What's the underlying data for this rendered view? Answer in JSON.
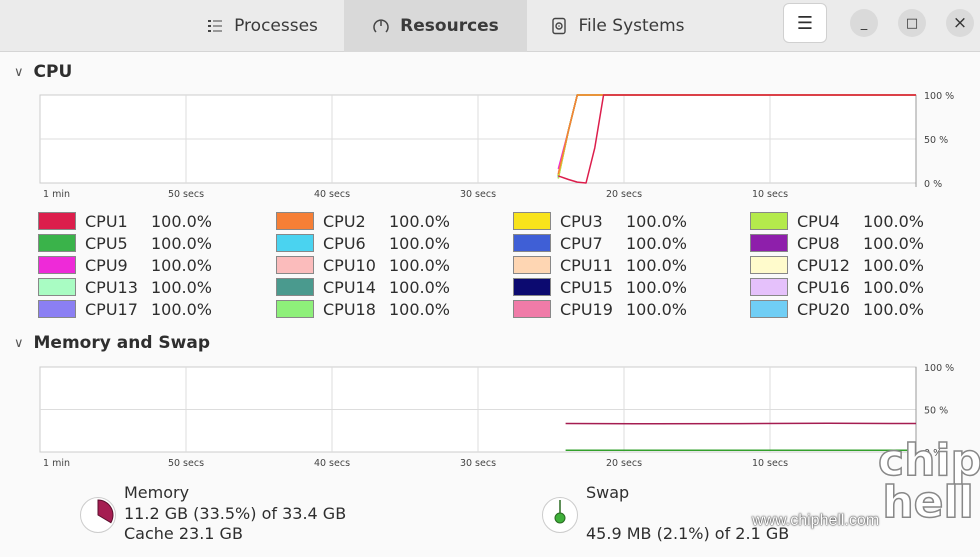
{
  "tabs": [
    {
      "label": "Processes",
      "icon": "list-icon"
    },
    {
      "label": "Resources",
      "icon": "gauge-icon",
      "active": true
    },
    {
      "label": "File Systems",
      "icon": "disk-icon"
    }
  ],
  "window": {
    "menu": "☰",
    "minimize": "_",
    "maximize": "□",
    "close": "×"
  },
  "cpu": {
    "title": "CPU",
    "x_labels": [
      "1 min",
      "50 secs",
      "40 secs",
      "30 secs",
      "20 secs",
      "10 secs"
    ],
    "y_labels": [
      "100 %",
      "50 %",
      "0 %"
    ],
    "legend": [
      {
        "name": "CPU1",
        "value": "100.0%",
        "color": "#dc1e4c"
      },
      {
        "name": "CPU2",
        "value": "100.0%",
        "color": "#f67f36"
      },
      {
        "name": "CPU3",
        "value": "100.0%",
        "color": "#f8e31c"
      },
      {
        "name": "CPU4",
        "value": "100.0%",
        "color": "#b4ea4c"
      },
      {
        "name": "CPU5",
        "value": "100.0%",
        "color": "#3ab34a"
      },
      {
        "name": "CPU6",
        "value": "100.0%",
        "color": "#4ad3f0"
      },
      {
        "name": "CPU7",
        "value": "100.0%",
        "color": "#3f5fd6"
      },
      {
        "name": "CPU8",
        "value": "100.0%",
        "color": "#8e1fab"
      },
      {
        "name": "CPU9",
        "value": "100.0%",
        "color": "#ee2ad8"
      },
      {
        "name": "CPU10",
        "value": "100.0%",
        "color": "#fbbcbc"
      },
      {
        "name": "CPU11",
        "value": "100.0%",
        "color": "#fed6b3"
      },
      {
        "name": "CPU12",
        "value": "100.0%",
        "color": "#fffbcc"
      },
      {
        "name": "CPU13",
        "value": "100.0%",
        "color": "#a9fcc3"
      },
      {
        "name": "CPU14",
        "value": "100.0%",
        "color": "#4a9a8e"
      },
      {
        "name": "CPU15",
        "value": "100.0%",
        "color": "#0c0a70"
      },
      {
        "name": "CPU16",
        "value": "100.0%",
        "color": "#e5c1fb"
      },
      {
        "name": "CPU17",
        "value": "100.0%",
        "color": "#8b7ff3"
      },
      {
        "name": "CPU18",
        "value": "100.0%",
        "color": "#8ef07a"
      },
      {
        "name": "CPU19",
        "value": "100.0%",
        "color": "#f07ba8"
      },
      {
        "name": "CPU20",
        "value": "100.0%",
        "color": "#70cef5"
      }
    ]
  },
  "memory": {
    "title": "Memory and Swap",
    "x_labels": [
      "1 min",
      "50 secs",
      "40 secs",
      "30 secs",
      "20 secs",
      "10 secs"
    ],
    "y_labels": [
      "100 %",
      "50 %",
      "0 %"
    ],
    "memory_label": "Memory",
    "memory_value": "11.2 GB (33.5%) of 33.4 GB",
    "cache": "Cache 23.1 GB",
    "memory_color": "#a51d51",
    "memory_fraction": 0.335,
    "swap_label": "Swap",
    "swap_value": "45.9 MB (2.1%) of 2.1 GB",
    "swap_color": "#33a02c",
    "swap_fraction": 0.021
  },
  "chart_data": [
    {
      "type": "line",
      "title": "CPU",
      "x_unit": "seconds ago",
      "xlim": [
        60,
        0
      ],
      "ylim": [
        0,
        100
      ],
      "grid": true,
      "x": [
        24.5,
        23.8,
        23.2,
        22.6,
        22,
        21.4,
        0
      ],
      "series": [
        {
          "name": "CPU1",
          "values": [
            8,
            4,
            1,
            0,
            40,
            100,
            100
          ]
        },
        {
          "name": "CPU2",
          "values": [
            10,
            60,
            100,
            100,
            100,
            100,
            100
          ]
        },
        {
          "name": "CPU3",
          "values": [
            9,
            60,
            100,
            100,
            100,
            100,
            100
          ]
        },
        {
          "name": "CPU4",
          "values": [
            5,
            60,
            100,
            100,
            100,
            100,
            100
          ]
        },
        {
          "name": "CPU5",
          "values": [
            8,
            60,
            100,
            100,
            100,
            100,
            100
          ]
        },
        {
          "name": "CPU6",
          "values": [
            7,
            60,
            100,
            100,
            100,
            100,
            100
          ]
        },
        {
          "name": "CPU7",
          "values": [
            9,
            60,
            100,
            100,
            100,
            100,
            100
          ]
        },
        {
          "name": "CPU8",
          "values": [
            6,
            60,
            100,
            100,
            100,
            100,
            100
          ]
        },
        {
          "name": "CPU9",
          "values": [
            16,
            60,
            100,
            100,
            100,
            100,
            100
          ]
        },
        {
          "name": "CPU10",
          "values": [
            10,
            60,
            100,
            100,
            100,
            100,
            100
          ]
        },
        {
          "name": "CPU11",
          "values": [
            12,
            60,
            100,
            100,
            100,
            100,
            100
          ]
        },
        {
          "name": "CPU12",
          "values": [
            8,
            60,
            100,
            100,
            100,
            100,
            100
          ]
        },
        {
          "name": "CPU13",
          "values": [
            7,
            60,
            100,
            100,
            100,
            100,
            100
          ]
        },
        {
          "name": "CPU14",
          "values": [
            8,
            60,
            100,
            100,
            100,
            100,
            100
          ]
        },
        {
          "name": "CPU15",
          "values": [
            9,
            60,
            100,
            100,
            100,
            100,
            100
          ]
        },
        {
          "name": "CPU16",
          "values": [
            10,
            60,
            100,
            100,
            100,
            100,
            100
          ]
        },
        {
          "name": "CPU17",
          "values": [
            8,
            60,
            100,
            100,
            100,
            100,
            100
          ]
        },
        {
          "name": "CPU18",
          "values": [
            6,
            60,
            100,
            100,
            100,
            100,
            100
          ]
        },
        {
          "name": "CPU19",
          "values": [
            9,
            60,
            100,
            100,
            100,
            100,
            100
          ]
        },
        {
          "name": "CPU20",
          "values": [
            8,
            60,
            100,
            100,
            100,
            100,
            100
          ]
        }
      ]
    },
    {
      "type": "line",
      "title": "Memory and Swap",
      "x_unit": "seconds ago",
      "xlim": [
        60,
        0
      ],
      "ylim": [
        0,
        100
      ],
      "grid": true,
      "x": [
        24,
        18,
        12,
        6,
        0
      ],
      "series": [
        {
          "name": "Memory",
          "values": [
            33.5,
            33.2,
            33.4,
            33.8,
            33.5
          ]
        },
        {
          "name": "Swap",
          "values": [
            2.1,
            2.1,
            2.1,
            2.1,
            2.1
          ]
        }
      ]
    }
  ],
  "watermark": {
    "text": "www.chiphell.com",
    "logo": "chip hell"
  }
}
